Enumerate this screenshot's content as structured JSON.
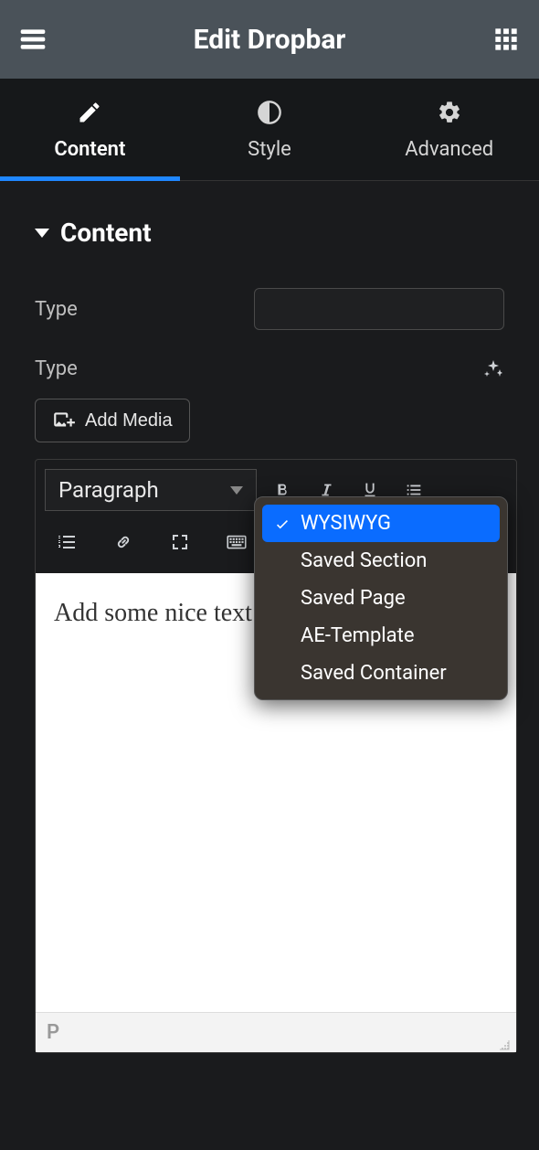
{
  "header": {
    "title": "Edit Dropbar"
  },
  "tabs": [
    {
      "label": "Content",
      "active": true
    },
    {
      "label": "Style",
      "active": false
    },
    {
      "label": "Advanced",
      "active": false
    }
  ],
  "section": {
    "title": "Content"
  },
  "fields": {
    "type1_label": "Type",
    "type2_label": "Type"
  },
  "dropdown": {
    "options": [
      {
        "label": "WYSIWYG",
        "selected": true
      },
      {
        "label": "Saved Section",
        "selected": false
      },
      {
        "label": "Saved Page",
        "selected": false
      },
      {
        "label": "AE-Template",
        "selected": false
      },
      {
        "label": "Saved Container",
        "selected": false
      }
    ]
  },
  "add_media_label": "Add Media",
  "editor": {
    "format_select": "Paragraph",
    "content": "Add some nice text here.",
    "status": "P"
  }
}
